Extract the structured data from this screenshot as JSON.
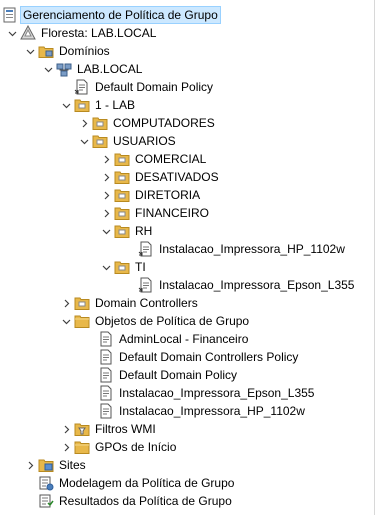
{
  "tree": {
    "root": "Gerenciamento de Política de Grupo",
    "forest": "Floresta: LAB.LOCAL",
    "domains": "Domínios",
    "domain": "LAB.LOCAL",
    "default_domain_policy": "Default Domain Policy",
    "ou_lab": "1 - LAB",
    "computadores": "COMPUTADORES",
    "usuarios": "USUARIOS",
    "comercial": "COMERCIAL",
    "desativados": "DESATIVADOS",
    "diretoria": "DIRETORIA",
    "financeiro": "FINANCEIRO",
    "rh": "RH",
    "rh_gpo": "Instalacao_Impressora_HP_1102w",
    "ti": "TI",
    "ti_gpo": "Instalacao_Impressora_Epson_L355",
    "domain_controllers": "Domain Controllers",
    "gpo_objects": "Objetos de Política de Grupo",
    "gpo_list": [
      "AdminLocal - Financeiro",
      "Default Domain Controllers Policy",
      "Default Domain Policy",
      "Instalacao_Impressora_Epson_L355",
      "Instalacao_Impressora_HP_1102w"
    ],
    "wmi_filters": "Filtros WMI",
    "starter_gpos": "GPOs de Início",
    "sites": "Sites",
    "modeling": "Modelagem da Política de Grupo",
    "results": "Resultados da Política de Grupo"
  },
  "colors": {
    "selection": "#cce8ff",
    "folder": "#e8b84a",
    "chevron": "#404040"
  }
}
